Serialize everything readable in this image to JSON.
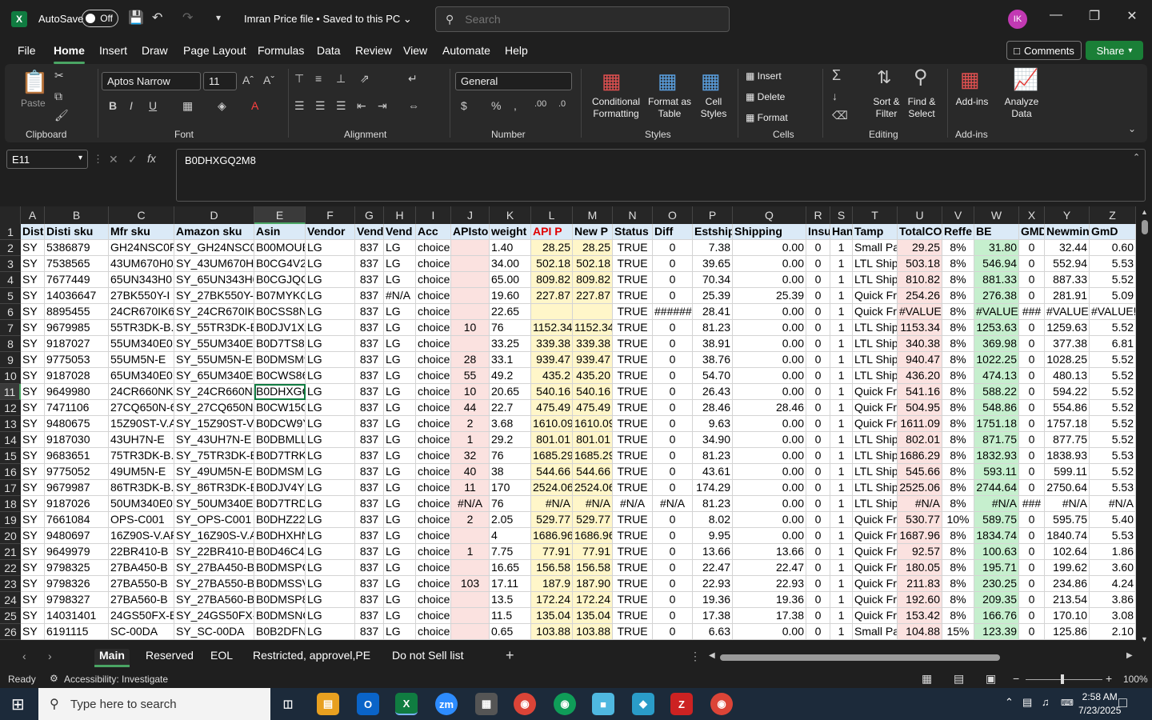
{
  "titlebar": {
    "autosave_label": "AutoSave",
    "autosave_state": "Off",
    "doc_title": "Imran Price file • Saved to this PC",
    "search_placeholder": "Search",
    "avatar_initials": "IK"
  },
  "menu": {
    "items": [
      "File",
      "Home",
      "Insert",
      "Draw",
      "Page Layout",
      "Formulas",
      "Data",
      "Review",
      "View",
      "Automate",
      "Help"
    ],
    "active": "Home",
    "comments": "Comments",
    "share": "Share"
  },
  "ribbon": {
    "paste": "Paste",
    "font_name": "Aptos Narrow",
    "font_size": "11",
    "number_format": "General",
    "conditional_formatting": "Conditional Formatting",
    "format_as_table": "Format as Table",
    "cell_styles": "Cell Styles",
    "insert": "Insert",
    "delete": "Delete",
    "format": "Format",
    "sort_filter": "Sort & Filter",
    "find_select": "Find & Select",
    "addins": "Add-ins",
    "analyze_data": "Analyze Data",
    "groups": [
      "Clipboard",
      "Font",
      "Alignment",
      "Number",
      "Styles",
      "Cells",
      "Editing",
      "Add-ins"
    ]
  },
  "formula": {
    "name_box": "E11",
    "content": "B0DHXGQ2M8"
  },
  "columns": [
    "A",
    "B",
    "C",
    "D",
    "E",
    "F",
    "G",
    "H",
    "I",
    "J",
    "K",
    "L",
    "M",
    "N",
    "O",
    "P",
    "Q",
    "R",
    "S",
    "T",
    "U",
    "V",
    "W",
    "X",
    "Y",
    "Z"
  ],
  "header_row": [
    "Disti",
    "Disti sku",
    "Mfr sku",
    "Amazon sku",
    "Asin",
    "Vendor",
    "Vendo",
    "Vend",
    "Acc",
    "APIstoc",
    "weight",
    "API P",
    "New P",
    "Status",
    "Diff",
    "Estship",
    "Shipping",
    "Insu",
    "Han",
    "Tamp",
    "TotalCO",
    "Reffe",
    "BE",
    "GMD",
    "Newmin",
    "GmD"
  ],
  "rows": [
    [
      "SY",
      "5386879",
      "GH24NSC0R",
      "SY_GH24NSC0R",
      "B00MOUB",
      "LG",
      "837",
      "LG",
      "choice",
      "",
      "1.40",
      "28.25",
      "28.25",
      "TRUE",
      "0",
      "7.38",
      "0.00",
      "0",
      "1",
      "Small Pa",
      "29.25",
      "8%",
      "31.80",
      "0",
      "32.44",
      "0.60"
    ],
    [
      "SY",
      "7538565",
      "43UM670H0U",
      "SY_43UM670H0U",
      "B0CG4V25",
      "LG",
      "837",
      "LG",
      "choice",
      "",
      "34.00",
      "502.18",
      "502.18",
      "TRUE",
      "0",
      "39.65",
      "0.00",
      "0",
      "1",
      "LTL Ship",
      "503.18",
      "8%",
      "546.94",
      "0",
      "552.94",
      "5.53"
    ],
    [
      "SY",
      "7677449",
      "65UN343H0",
      "SY_65UN343H0",
      "B0CGJQCJ",
      "LG",
      "837",
      "LG",
      "choice",
      "",
      "65.00",
      "809.82",
      "809.82",
      "TRUE",
      "0",
      "70.34",
      "0.00",
      "0",
      "1",
      "LTL Ship",
      "810.82",
      "8%",
      "881.33",
      "0",
      "887.33",
      "5.52"
    ],
    [
      "SY",
      "14036647",
      "27BK550Y-I",
      "SY_27BK550Y-I",
      "B07MYKC2",
      "LG",
      "837",
      "#N/A",
      "choice",
      "",
      "19.60",
      "227.87",
      "227.87",
      "TRUE",
      "0",
      "25.39",
      "25.39",
      "0",
      "1",
      "Quick Fr",
      "254.26",
      "8%",
      "276.38",
      "0",
      "281.91",
      "5.09"
    ],
    [
      "SY",
      "8895455",
      "24CR670IK6P",
      "SY_24CR670IK6P",
      "B0CSS8NK",
      "LG",
      "837",
      "LG",
      "choice",
      "",
      "22.65",
      "",
      "",
      "TRUE",
      "######",
      "28.41",
      "0.00",
      "0",
      "1",
      "Quick Fr",
      "#VALUE!",
      "8%",
      "#VALUE!",
      "###",
      "#VALUE!",
      "#VALUE!"
    ],
    [
      "SY",
      "9679985",
      "55TR3DK-B.M",
      "SY_55TR3DK-B.M",
      "B0DJV1XH",
      "LG",
      "837",
      "LG",
      "choice",
      "10",
      "76",
      "1152.34",
      "1152.34",
      "TRUE",
      "0",
      "81.23",
      "0.00",
      "0",
      "1",
      "LTL Ship",
      "1153.34",
      "8%",
      "1253.63",
      "0",
      "1259.63",
      "5.52"
    ],
    [
      "SY",
      "9187027",
      "55UM340E0U",
      "SY_55UM340E0U",
      "B0D7TS85",
      "LG",
      "837",
      "LG",
      "choice",
      "",
      "33.25",
      "339.38",
      "339.38",
      "TRUE",
      "0",
      "38.91",
      "0.00",
      "0",
      "1",
      "LTL Ship",
      "340.38",
      "8%",
      "369.98",
      "0",
      "377.38",
      "6.81"
    ],
    [
      "SY",
      "9775053",
      "55UM5N-E",
      "SY_55UM5N-E",
      "B0DMSM9",
      "LG",
      "837",
      "LG",
      "choice",
      "28",
      "33.1",
      "939.47",
      "939.47",
      "TRUE",
      "0",
      "38.76",
      "0.00",
      "0",
      "1",
      "LTL Ship",
      "940.47",
      "8%",
      "1022.25",
      "0",
      "1028.25",
      "5.52"
    ],
    [
      "SY",
      "9187028",
      "65UM340E0U",
      "SY_65UM340E0U",
      "B0CWS86L",
      "LG",
      "837",
      "LG",
      "choice",
      "55",
      "49.2",
      "435.2",
      "435.20",
      "TRUE",
      "0",
      "54.70",
      "0.00",
      "0",
      "1",
      "LTL Ship",
      "436.20",
      "8%",
      "474.13",
      "0",
      "480.13",
      "5.52"
    ],
    [
      "SY",
      "9649980",
      "24CR660NK6P",
      "SY_24CR660NK6",
      "B0DHXGQ",
      "LG",
      "837",
      "LG",
      "choice",
      "10",
      "20.65",
      "540.16",
      "540.16",
      "TRUE",
      "0",
      "26.43",
      "0.00",
      "0",
      "1",
      "Quick Fr",
      "541.16",
      "8%",
      "588.22",
      "0",
      "594.22",
      "5.52"
    ],
    [
      "SY",
      "7471106",
      "27CQ650N-6N",
      "SY_27CQ650N-6",
      "B0CW15Q",
      "LG",
      "837",
      "LG",
      "choice",
      "44",
      "22.7",
      "475.49",
      "475.49",
      "TRUE",
      "0",
      "28.46",
      "28.46",
      "0",
      "1",
      "Quick Fr",
      "504.95",
      "8%",
      "548.86",
      "0",
      "554.86",
      "5.52"
    ],
    [
      "SY",
      "9480675",
      "15Z90ST-V.AP",
      "SY_15Z90ST-V.AI",
      "B0DCW9YJ",
      "LG",
      "837",
      "LG",
      "choice",
      "2",
      "3.68",
      "1610.09",
      "1610.09",
      "TRUE",
      "0",
      "9.63",
      "0.00",
      "0",
      "1",
      "Quick Fr",
      "1611.09",
      "8%",
      "1751.18",
      "0",
      "1757.18",
      "5.52"
    ],
    [
      "SY",
      "9187030",
      "43UH7N-E",
      "SY_43UH7N-E",
      "B0DBMLLV",
      "LG",
      "837",
      "LG",
      "choice",
      "1",
      "29.2",
      "801.01",
      "801.01",
      "TRUE",
      "0",
      "34.90",
      "0.00",
      "0",
      "1",
      "LTL Ship",
      "802.01",
      "8%",
      "871.75",
      "0",
      "877.75",
      "5.52"
    ],
    [
      "SY",
      "9683651",
      "75TR3DK-B.M",
      "SY_75TR3DK-B.M",
      "B0D7TRKP",
      "LG",
      "837",
      "LG",
      "choice",
      "32",
      "76",
      "1685.29",
      "1685.29",
      "TRUE",
      "0",
      "81.23",
      "0.00",
      "0",
      "1",
      "LTL Ship",
      "1686.29",
      "8%",
      "1832.93",
      "0",
      "1838.93",
      "5.53"
    ],
    [
      "SY",
      "9775052",
      "49UM5N-E",
      "SY_49UM5N-E",
      "B0DMSMB",
      "LG",
      "837",
      "LG",
      "choice",
      "40",
      "38",
      "544.66",
      "544.66",
      "TRUE",
      "0",
      "43.61",
      "0.00",
      "0",
      "1",
      "LTL Ship",
      "545.66",
      "8%",
      "593.11",
      "0",
      "599.11",
      "5.52"
    ],
    [
      "SY",
      "9679987",
      "86TR3DK-B.Y",
      "SY_86TR3DK-B.Y",
      "B0DJV4Y8",
      "LG",
      "837",
      "LG",
      "choice",
      "11",
      "170",
      "2524.06",
      "2524.06",
      "TRUE",
      "0",
      "174.29",
      "0.00",
      "0",
      "1",
      "LTL Ship",
      "2525.06",
      "8%",
      "2744.64",
      "0",
      "2750.64",
      "5.53"
    ],
    [
      "SY",
      "9187026",
      "50UM340E0U",
      "SY_50UM340E0U",
      "B0D7TRD3",
      "LG",
      "837",
      "LG",
      "choice",
      "#N/A",
      "76",
      "#N/A",
      "#N/A",
      "#N/A",
      "#N/A",
      "81.23",
      "0.00",
      "0",
      "1",
      "LTL Ship",
      "#N/A",
      "8%",
      "#N/A",
      "###",
      "#N/A",
      "#N/A"
    ],
    [
      "SY",
      "7661084",
      "OPS-C001",
      "SY_OPS-C001",
      "B0DHZ226",
      "LG",
      "837",
      "LG",
      "choice",
      "2",
      "2.05",
      "529.77",
      "529.77",
      "TRUE",
      "0",
      "8.02",
      "0.00",
      "0",
      "1",
      "Quick Fr",
      "530.77",
      "10%",
      "589.75",
      "0",
      "595.75",
      "5.40"
    ],
    [
      "SY",
      "9480697",
      "16Z90S-V.APC",
      "SY_16Z90S-V.AP",
      "B0DHXHN",
      "LG",
      "837",
      "LG",
      "choice",
      "",
      "4",
      "1686.96",
      "1686.96",
      "TRUE",
      "0",
      "9.95",
      "0.00",
      "0",
      "1",
      "Quick Fr",
      "1687.96",
      "8%",
      "1834.74",
      "0",
      "1840.74",
      "5.53"
    ],
    [
      "SY",
      "9649979",
      "22BR410-B",
      "SY_22BR410-B",
      "B0D46C4T",
      "LG",
      "837",
      "LG",
      "choice",
      "1",
      "7.75",
      "77.91",
      "77.91",
      "TRUE",
      "0",
      "13.66",
      "13.66",
      "0",
      "1",
      "Quick Fr",
      "92.57",
      "8%",
      "100.63",
      "0",
      "102.64",
      "1.86"
    ],
    [
      "SY",
      "9798325",
      "27BA450-B",
      "SY_27BA450-B",
      "B0DMSPC",
      "LG",
      "837",
      "LG",
      "choice",
      "",
      "16.65",
      "156.58",
      "156.58",
      "TRUE",
      "0",
      "22.47",
      "22.47",
      "0",
      "1",
      "Quick Fr",
      "180.05",
      "8%",
      "195.71",
      "0",
      "199.62",
      "3.60"
    ],
    [
      "SY",
      "9798326",
      "27BA550-B",
      "SY_27BA550-B",
      "B0DMSSV",
      "LG",
      "837",
      "LG",
      "choice",
      "103",
      "17.11",
      "187.9",
      "187.90",
      "TRUE",
      "0",
      "22.93",
      "22.93",
      "0",
      "1",
      "Quick Fr",
      "211.83",
      "8%",
      "230.25",
      "0",
      "234.86",
      "4.24"
    ],
    [
      "SY",
      "9798327",
      "27BA560-B",
      "SY_27BA560-B",
      "B0DMSP8",
      "LG",
      "837",
      "LG",
      "choice",
      "",
      "13.5",
      "172.24",
      "172.24",
      "TRUE",
      "0",
      "19.36",
      "19.36",
      "0",
      "1",
      "Quick Fr",
      "192.60",
      "8%",
      "209.35",
      "0",
      "213.54",
      "3.86"
    ],
    [
      "SY",
      "14031401",
      "24GS50FX-B",
      "SY_24GS50FX-B",
      "B0DMSNQ",
      "LG",
      "837",
      "LG",
      "choice",
      "",
      "11.5",
      "135.04",
      "135.04",
      "TRUE",
      "0",
      "17.38",
      "17.38",
      "0",
      "1",
      "Quick Fr",
      "153.42",
      "8%",
      "166.76",
      "0",
      "170.10",
      "3.08"
    ],
    [
      "SY",
      "6191115",
      "SC-00DA",
      "SY_SC-00DA",
      "B0B2DFN3",
      "LG",
      "837",
      "LG",
      "choice",
      "",
      "0.65",
      "103.88",
      "103.88",
      "TRUE",
      "0",
      "6.63",
      "0.00",
      "0",
      "1",
      "Small Pa",
      "104.88",
      "15%",
      "123.39",
      "0",
      "125.86",
      "2.10"
    ]
  ],
  "row_numbers": [
    "1",
    "2",
    "3",
    "4",
    "5",
    "6",
    "7",
    "8",
    "9",
    "10",
    "11",
    "12",
    "13",
    "14",
    "15",
    "16",
    "17",
    "18",
    "19",
    "20",
    "21",
    "22",
    "23",
    "24",
    "25",
    "26"
  ],
  "sheets": [
    "Main",
    "Reserved",
    "EOL",
    "Restricted, approvel,PE",
    "Do not Sell list"
  ],
  "active_sheet": "Main",
  "status": {
    "ready": "Ready",
    "accessibility": "Accessibility: Investigate",
    "zoom": "100%"
  },
  "taskbar": {
    "search_placeholder": "Type here to search",
    "time": "2:58 AM",
    "date": "7/23/2025"
  }
}
